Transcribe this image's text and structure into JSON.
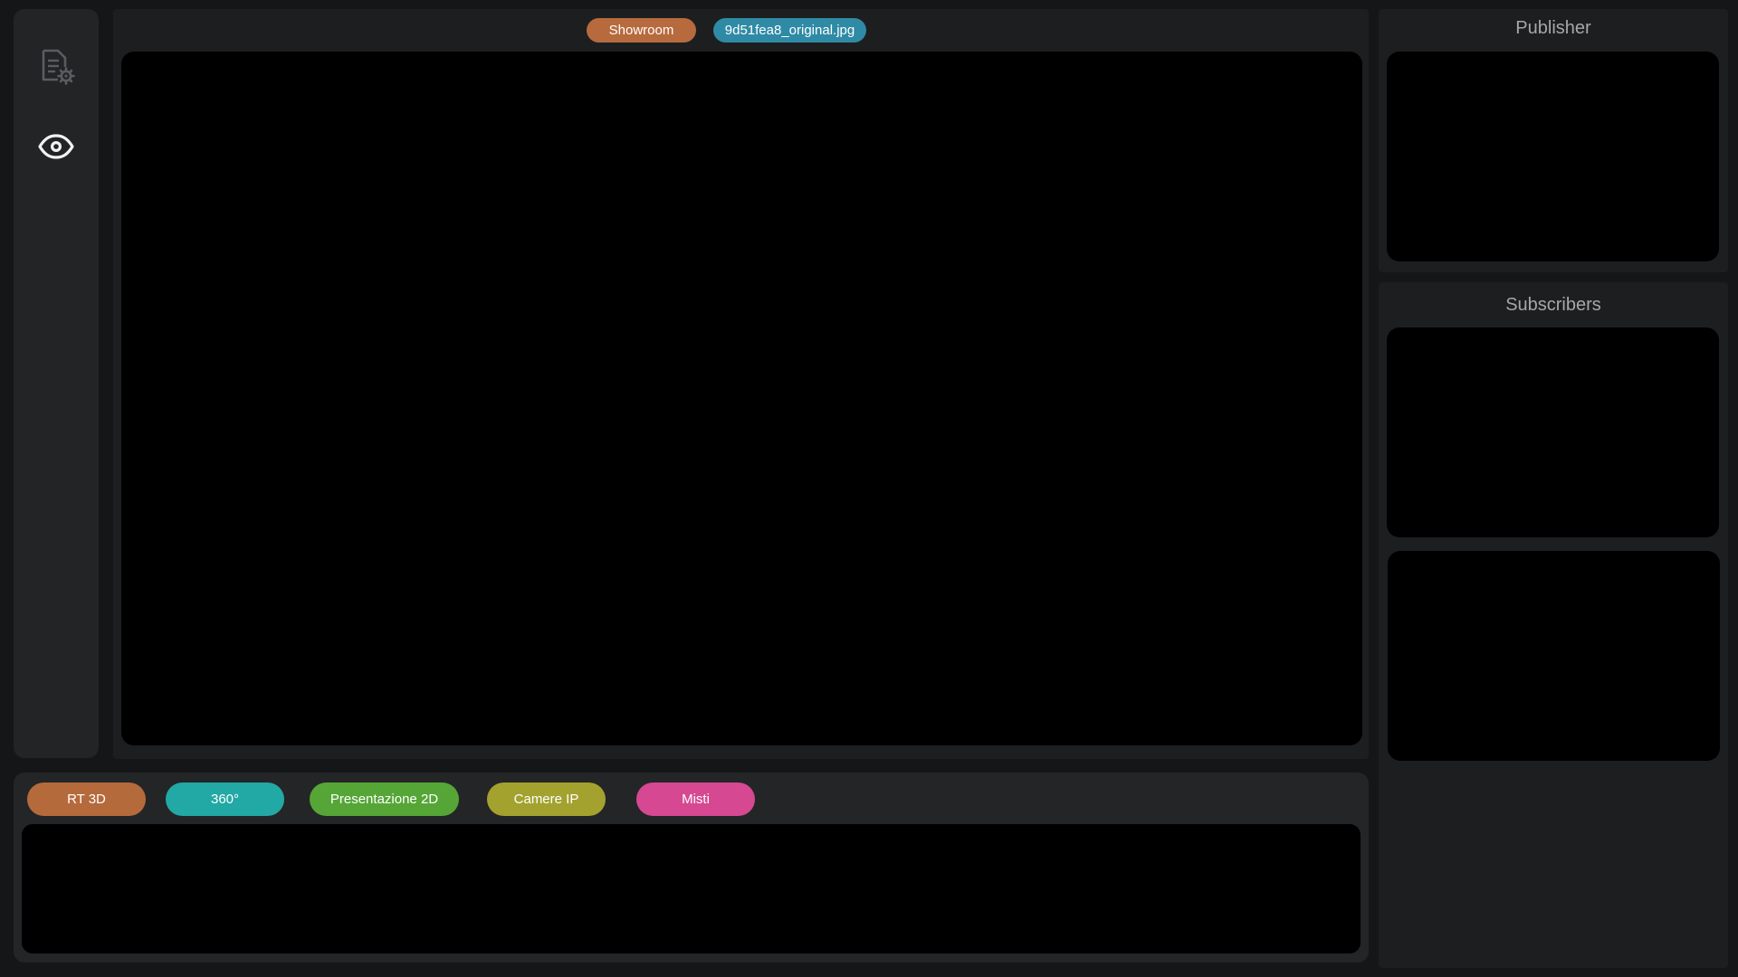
{
  "sidebar": {
    "items": [
      {
        "icon": "document-settings-icon"
      },
      {
        "icon": "eye-icon"
      }
    ]
  },
  "main": {
    "tags": [
      {
        "label": "Showroom",
        "color": "#b76a3d"
      },
      {
        "label": "9d51fea8_original.jpg",
        "color": "#2f8aa5"
      }
    ]
  },
  "bottom": {
    "categories": [
      {
        "label": "RT 3D",
        "color": "#b56a3c"
      },
      {
        "label": "360°",
        "color": "#22a8a5"
      },
      {
        "label": "Presentazione 2D",
        "color": "#56a637"
      },
      {
        "label": "Camere IP",
        "color": "#a3a22e"
      },
      {
        "label": "Misti",
        "color": "#d64892"
      }
    ]
  },
  "right": {
    "publisher_title": "Publisher",
    "subscribers_title": "Subscribers"
  }
}
